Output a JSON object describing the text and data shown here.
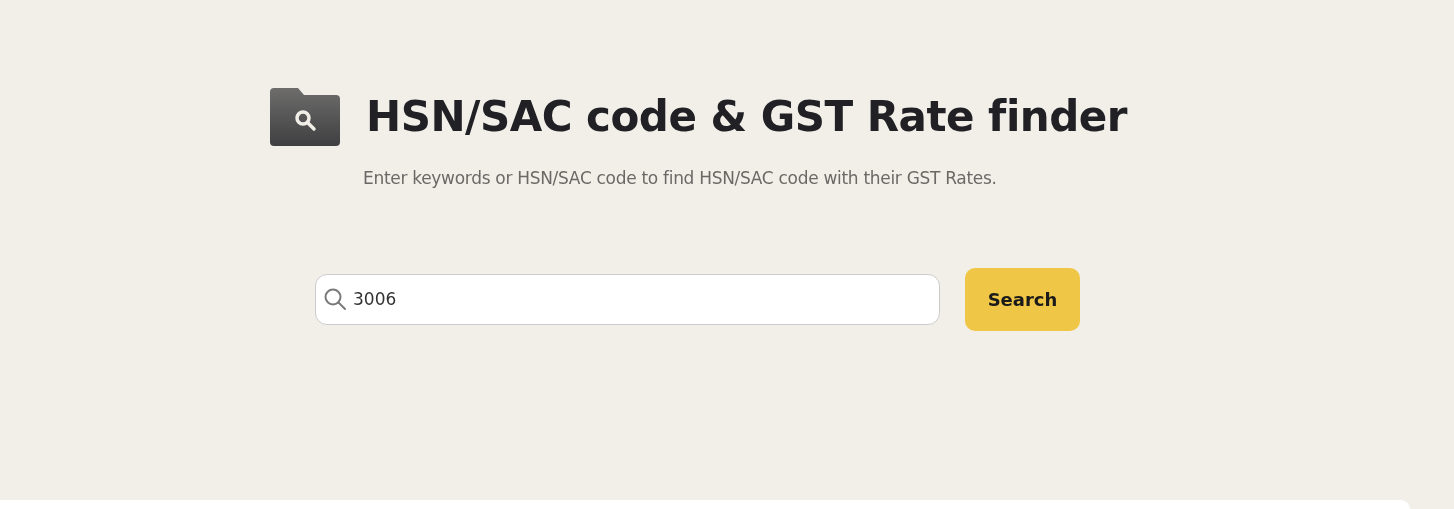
{
  "title": "HSN/SAC code & GST Rate finder",
  "subtitle": "Enter keywords or HSN/SAC code to find HSN/SAC code with their GST Rates.",
  "search": {
    "value": "3006",
    "button": "Search"
  }
}
